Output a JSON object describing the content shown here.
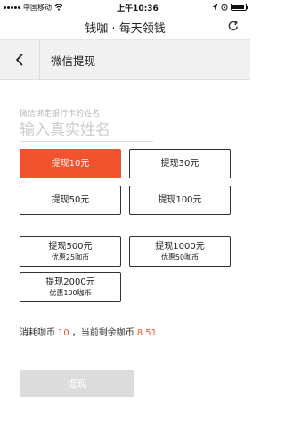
{
  "status_bar": {
    "carrier": "中国移动",
    "time": "上午10:36",
    "icons": [
      "signal-icon",
      "wifi-icon",
      "location-icon",
      "alarm-icon",
      "battery-icon"
    ]
  },
  "app_bar": {
    "title": "钱咖 · 每天领钱",
    "reload_icon": "reload-icon"
  },
  "sub_header": {
    "back_icon": "chevron-left-icon",
    "title": "微信提现"
  },
  "form": {
    "name_label": "微信绑定银行卡的姓名",
    "name_placeholder": "输入真实姓名",
    "name_value": ""
  },
  "options": [
    {
      "label": "提现10元",
      "note": "",
      "selected": true
    },
    {
      "label": "提现30元",
      "note": "",
      "selected": false
    },
    {
      "label": "提现50元",
      "note": "",
      "selected": false
    },
    {
      "label": "提现100元",
      "note": "",
      "selected": false
    },
    {
      "label": "提现500元",
      "note": "优惠25咖币",
      "selected": false
    },
    {
      "label": "提现1000元",
      "note": "优惠50咖币",
      "selected": false
    },
    {
      "label": "提现2000元",
      "note": "优惠100咖币",
      "selected": false
    }
  ],
  "consume": {
    "prefix": "消耗咖币",
    "cost": "10",
    "middle": "，当前剩余咖币",
    "balance": "8.51"
  },
  "submit_label": "提现",
  "colors": {
    "accent": "#f0532d",
    "disabled_button": "#dcdcdc",
    "subheader_bg": "#f1f1f1"
  }
}
